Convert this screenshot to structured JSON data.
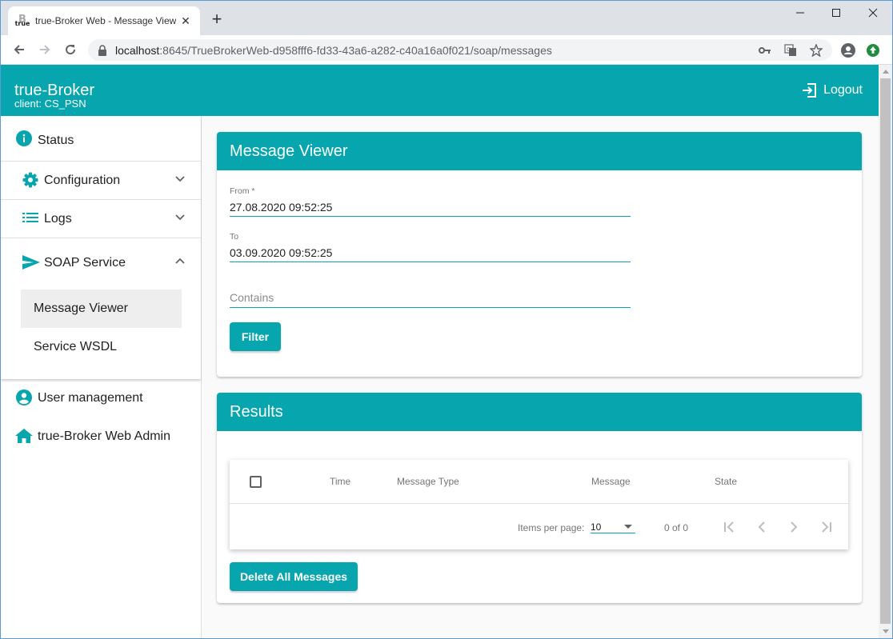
{
  "browser": {
    "tab_title": "true-Broker Web - Message Viewer",
    "favicon_text": "true",
    "url_host": "localhost",
    "url_rest": ":8645/TrueBrokerWeb-d958fff6-fd33-43a6-a282-c40a16a0f021/soap/messages"
  },
  "header": {
    "title": "true-Broker",
    "client": "client: CS_PSN",
    "logout_label": "Logout"
  },
  "sidebar": {
    "status": "Status",
    "configuration": "Configuration",
    "logs": "Logs",
    "soap_service": "SOAP Service",
    "sub_items": [
      "Message Viewer",
      "Service WSDL"
    ],
    "user_management": "User management",
    "web_admin": "true-Broker Web Admin"
  },
  "viewer": {
    "title": "Message Viewer",
    "from_label": "From *",
    "from_value": "27.08.2020 09:52:25",
    "to_label": "To",
    "to_value": "03.09.2020 09:52:25",
    "contains_placeholder": "Contains",
    "filter_label": "Filter"
  },
  "results": {
    "title": "Results",
    "columns": [
      "Time",
      "Message Type",
      "Message",
      "State"
    ],
    "items_per_page_label": "Items per page:",
    "items_per_page_value": "10",
    "range_label": "0 of 0",
    "delete_all_label": "Delete All Messages"
  },
  "colors": {
    "accent": "#07a5ad"
  }
}
